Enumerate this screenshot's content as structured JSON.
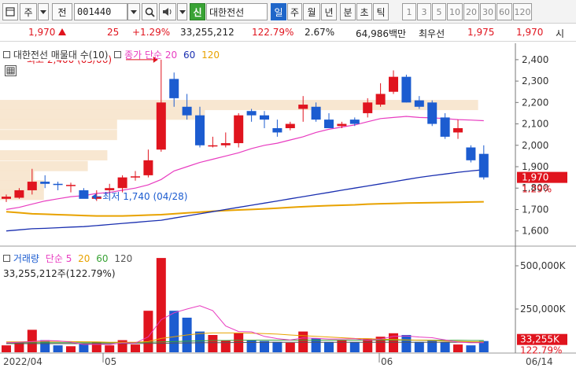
{
  "toolbar": {
    "period_type": "주",
    "prev_label": "전",
    "code": "001440",
    "badge": "신",
    "stock_name": "대한전선",
    "periods": [
      "일",
      "주",
      "월",
      "년",
      "분",
      "초",
      "틱"
    ],
    "selected_period": "일",
    "intervals": [
      "1",
      "3",
      "5",
      "10",
      "20",
      "30",
      "60",
      "120"
    ]
  },
  "quote": {
    "price": "1,970",
    "change": "25",
    "change_pct": "+1.29%",
    "volume": "33,255,212",
    "volume_ratio": "122.79%",
    "turnover_pct": "2.67%",
    "amount": "64,986백만",
    "high_label": "최우선",
    "ask": "1,975",
    "bid": "1,970",
    "tail": "시"
  },
  "price_panel": {
    "legend_title": "대한전선 매물대 수(10)",
    "legend_ma_title": "종가 단순",
    "ma_periods": [
      "20",
      "60",
      "120"
    ],
    "ma_colors": [
      "#e83cc0",
      "#1a2fb0",
      "#e8a200"
    ],
    "high_annotation": "최고 2,400 (05/06)",
    "low_annotation": "최저 1,740 (04/28)",
    "axis_labels": [
      "2,400",
      "2,300",
      "2,200",
      "2,100",
      "2,000",
      "1,900",
      "1,800",
      "1,700",
      "1,600"
    ],
    "price_tag": "1,970",
    "pct_tag": "1.29%"
  },
  "volume_panel": {
    "legend_title": "거래량",
    "legend_ma_title": "단순",
    "ma_periods": [
      "5",
      "20",
      "60",
      "120"
    ],
    "ma_colors": [
      "#e83cc0",
      "#e8a200",
      "#39a335",
      "#555555"
    ],
    "summary": "33,255,212주(122.79%)",
    "axis_labels": [
      "500,000K",
      "250,000K"
    ],
    "volume_tag": "33,255K",
    "pct_tag": "122.79%"
  },
  "date_axis": [
    "2022/04",
    "05",
    "06",
    "06/14"
  ],
  "colors": {
    "up": "#e0141e",
    "down": "#1c5cd0",
    "selected": "#1f66c9"
  },
  "chart_data": {
    "type": "candlestick",
    "price_range": [
      1540,
      2440
    ],
    "volume_range": [
      0,
      550
    ],
    "candles": [
      {
        "o": 1750,
        "h": 1770,
        "l": 1735,
        "c": 1760,
        "v": 40
      },
      {
        "o": 1755,
        "h": 1800,
        "l": 1750,
        "c": 1790,
        "v": 60
      },
      {
        "o": 1790,
        "h": 1890,
        "l": 1770,
        "c": 1830,
        "v": 130
      },
      {
        "o": 1830,
        "h": 1860,
        "l": 1800,
        "c": 1820,
        "v": 70
      },
      {
        "o": 1820,
        "h": 1830,
        "l": 1790,
        "c": 1815,
        "v": 40
      },
      {
        "o": 1815,
        "h": 1825,
        "l": 1780,
        "c": 1815,
        "v": 35
      },
      {
        "o": 1790,
        "h": 1800,
        "l": 1760,
        "c": 1750,
        "v": 50
      },
      {
        "o": 1750,
        "h": 1790,
        "l": 1740,
        "c": 1760,
        "v": 60
      },
      {
        "o": 1790,
        "h": 1820,
        "l": 1770,
        "c": 1800,
        "v": 40
      },
      {
        "o": 1800,
        "h": 1860,
        "l": 1780,
        "c": 1850,
        "v": 70
      },
      {
        "o": 1850,
        "h": 1880,
        "l": 1835,
        "c": 1855,
        "v": 45
      },
      {
        "o": 1860,
        "h": 1980,
        "l": 1850,
        "c": 1930,
        "v": 240
      },
      {
        "o": 1980,
        "h": 2400,
        "l": 1970,
        "c": 2200,
        "v": 545
      },
      {
        "o": 2310,
        "h": 2340,
        "l": 2180,
        "c": 2220,
        "v": 240
      },
      {
        "o": 2180,
        "h": 2240,
        "l": 2120,
        "c": 2140,
        "v": 200
      },
      {
        "o": 2140,
        "h": 2180,
        "l": 1990,
        "c": 2000,
        "v": 120
      },
      {
        "o": 2000,
        "h": 2040,
        "l": 1990,
        "c": 2000,
        "v": 100
      },
      {
        "o": 2000,
        "h": 2060,
        "l": 1990,
        "c": 2010,
        "v": 70
      },
      {
        "o": 2010,
        "h": 2150,
        "l": 1990,
        "c": 2140,
        "v": 110
      },
      {
        "o": 2160,
        "h": 2170,
        "l": 2110,
        "c": 2140,
        "v": 70
      },
      {
        "o": 2140,
        "h": 2160,
        "l": 2080,
        "c": 2120,
        "v": 65
      },
      {
        "o": 2080,
        "h": 2120,
        "l": 2040,
        "c": 2060,
        "v": 60
      },
      {
        "o": 2080,
        "h": 2110,
        "l": 2070,
        "c": 2100,
        "v": 55
      },
      {
        "o": 2170,
        "h": 2230,
        "l": 2110,
        "c": 2190,
        "v": 120
      },
      {
        "o": 2180,
        "h": 2200,
        "l": 2110,
        "c": 2120,
        "v": 80
      },
      {
        "o": 2120,
        "h": 2150,
        "l": 2080,
        "c": 2080,
        "v": 60
      },
      {
        "o": 2090,
        "h": 2110,
        "l": 2080,
        "c": 2100,
        "v": 70
      },
      {
        "o": 2120,
        "h": 2130,
        "l": 2090,
        "c": 2100,
        "v": 60
      },
      {
        "o": 2150,
        "h": 2220,
        "l": 2130,
        "c": 2200,
        "v": 80
      },
      {
        "o": 2190,
        "h": 2290,
        "l": 2180,
        "c": 2240,
        "v": 90
      },
      {
        "o": 2250,
        "h": 2350,
        "l": 2240,
        "c": 2320,
        "v": 110
      },
      {
        "o": 2320,
        "h": 2330,
        "l": 2200,
        "c": 2200,
        "v": 100
      },
      {
        "o": 2210,
        "h": 2230,
        "l": 2170,
        "c": 2180,
        "v": 60
      },
      {
        "o": 2200,
        "h": 2210,
        "l": 2090,
        "c": 2100,
        "v": 70
      },
      {
        "o": 2130,
        "h": 2150,
        "l": 2030,
        "c": 2040,
        "v": 60
      },
      {
        "o": 2060,
        "h": 2120,
        "l": 2030,
        "c": 2080,
        "v": 45
      },
      {
        "o": 1990,
        "h": 2000,
        "l": 1920,
        "c": 1930,
        "v": 40
      },
      {
        "o": 1960,
        "h": 2000,
        "l": 1840,
        "c": 1850,
        "v": 65
      }
    ],
    "ma20": [
      1700,
      1710,
      1725,
      1740,
      1750,
      1760,
      1765,
      1775,
      1780,
      1790,
      1800,
      1815,
      1840,
      1880,
      1900,
      1920,
      1935,
      1950,
      1965,
      1985,
      2000,
      2010,
      2025,
      2040,
      2060,
      2075,
      2085,
      2095,
      2110,
      2125,
      2130,
      2135,
      2130,
      2128,
      2125,
      2120,
      2118,
      2115
    ],
    "ma60": [
      1600,
      1605,
      1610,
      1612,
      1615,
      1618,
      1620,
      1625,
      1630,
      1635,
      1640,
      1645,
      1650,
      1660,
      1670,
      1680,
      1690,
      1700,
      1710,
      1720,
      1730,
      1740,
      1750,
      1760,
      1770,
      1780,
      1790,
      1800,
      1810,
      1820,
      1830,
      1840,
      1850,
      1858,
      1866,
      1874,
      1880,
      1886
    ],
    "ma120": [
      1690,
      1685,
      1680,
      1678,
      1676,
      1674,
      1672,
      1670,
      1670,
      1670,
      1672,
      1674,
      1676,
      1680,
      1684,
      1688,
      1692,
      1695,
      1698,
      1700,
      1703,
      1706,
      1710,
      1713,
      1716,
      1718,
      1720,
      1722,
      1725,
      1727,
      1728,
      1730,
      1731,
      1732,
      1733,
      1734,
      1735,
      1736
    ],
    "vma5": [
      55,
      58,
      62,
      68,
      66,
      59,
      45,
      46,
      45,
      54,
      53,
      89,
      188,
      228,
      250,
      269,
      241,
      152,
      120,
      118,
      92,
      79,
      71,
      83,
      81,
      77,
      77,
      78,
      70,
      76,
      92,
      94,
      88,
      84,
      72,
      59,
      55,
      56
    ],
    "vma20": [
      60,
      60,
      62,
      63,
      63,
      62,
      61,
      60,
      58,
      58,
      58,
      62,
      80,
      90,
      100,
      108,
      112,
      112,
      112,
      110,
      108,
      105,
      100,
      96,
      92,
      88,
      84,
      80,
      78,
      76,
      74,
      72,
      70,
      68,
      65,
      63,
      61,
      60
    ],
    "vma60": [
      55,
      55,
      56,
      56,
      56,
      56,
      56,
      56,
      56,
      57,
      57,
      58,
      60,
      62,
      64,
      66,
      68,
      68,
      69,
      70,
      70,
      70,
      70,
      70,
      70,
      70,
      70,
      70,
      70,
      70,
      70,
      70,
      70,
      70,
      69,
      69,
      68,
      68
    ],
    "vma120": [
      50,
      50,
      50,
      50,
      50,
      50,
      50,
      50,
      50,
      50,
      51,
      51,
      52,
      53,
      54,
      55,
      56,
      56,
      57,
      57,
      58,
      58,
      58,
      58,
      58,
      58,
      58,
      58,
      58,
      58,
      58,
      58,
      58,
      58,
      58,
      58,
      58,
      58
    ],
    "volume_profile": [
      {
        "price": 2190,
        "width": 0.98
      },
      {
        "price": 2145,
        "width": 0.42
      },
      {
        "price": 2100,
        "width": 0.24
      },
      {
        "price": 2050,
        "width": 0.24
      },
      {
        "price": 1955,
        "width": 0.22
      },
      {
        "price": 1905,
        "width": 0.18
      },
      {
        "price": 1860,
        "width": 0.07
      },
      {
        "price": 1815,
        "width": 0.09
      },
      {
        "price": 1770,
        "width": 0.09
      }
    ]
  }
}
